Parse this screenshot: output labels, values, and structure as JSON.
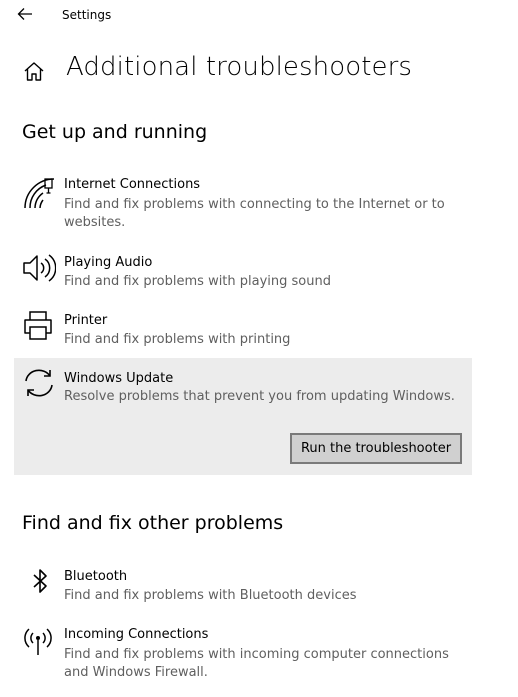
{
  "window": {
    "title": "Settings"
  },
  "page": {
    "title": "Additional troubleshooters"
  },
  "sections": [
    {
      "heading": "Get up and running",
      "items": [
        {
          "name": "Internet Connections",
          "description": "Find and fix problems with connecting to the Internet or to websites.",
          "icon": "wifi-icon"
        },
        {
          "name": "Playing Audio",
          "description": "Find and fix problems with playing sound",
          "icon": "speaker-icon"
        },
        {
          "name": "Printer",
          "description": "Find and fix problems with printing",
          "icon": "printer-icon"
        },
        {
          "name": "Windows Update",
          "description": "Resolve problems that prevent you from updating Windows.",
          "icon": "sync-icon",
          "selected": true,
          "button_label": "Run the troubleshooter"
        }
      ]
    },
    {
      "heading": "Find and fix other problems",
      "items": [
        {
          "name": "Bluetooth",
          "description": "Find and fix problems with Bluetooth devices",
          "icon": "bluetooth-icon"
        },
        {
          "name": "Incoming Connections",
          "description": "Find and fix problems with incoming computer connections and Windows Firewall.",
          "icon": "antenna-icon"
        }
      ]
    }
  ],
  "colors": {
    "selected_bg": "#ececec",
    "button_bg": "#d0d0d0",
    "button_border": "#7a7a7a",
    "description_text": "#5f5f5f"
  }
}
